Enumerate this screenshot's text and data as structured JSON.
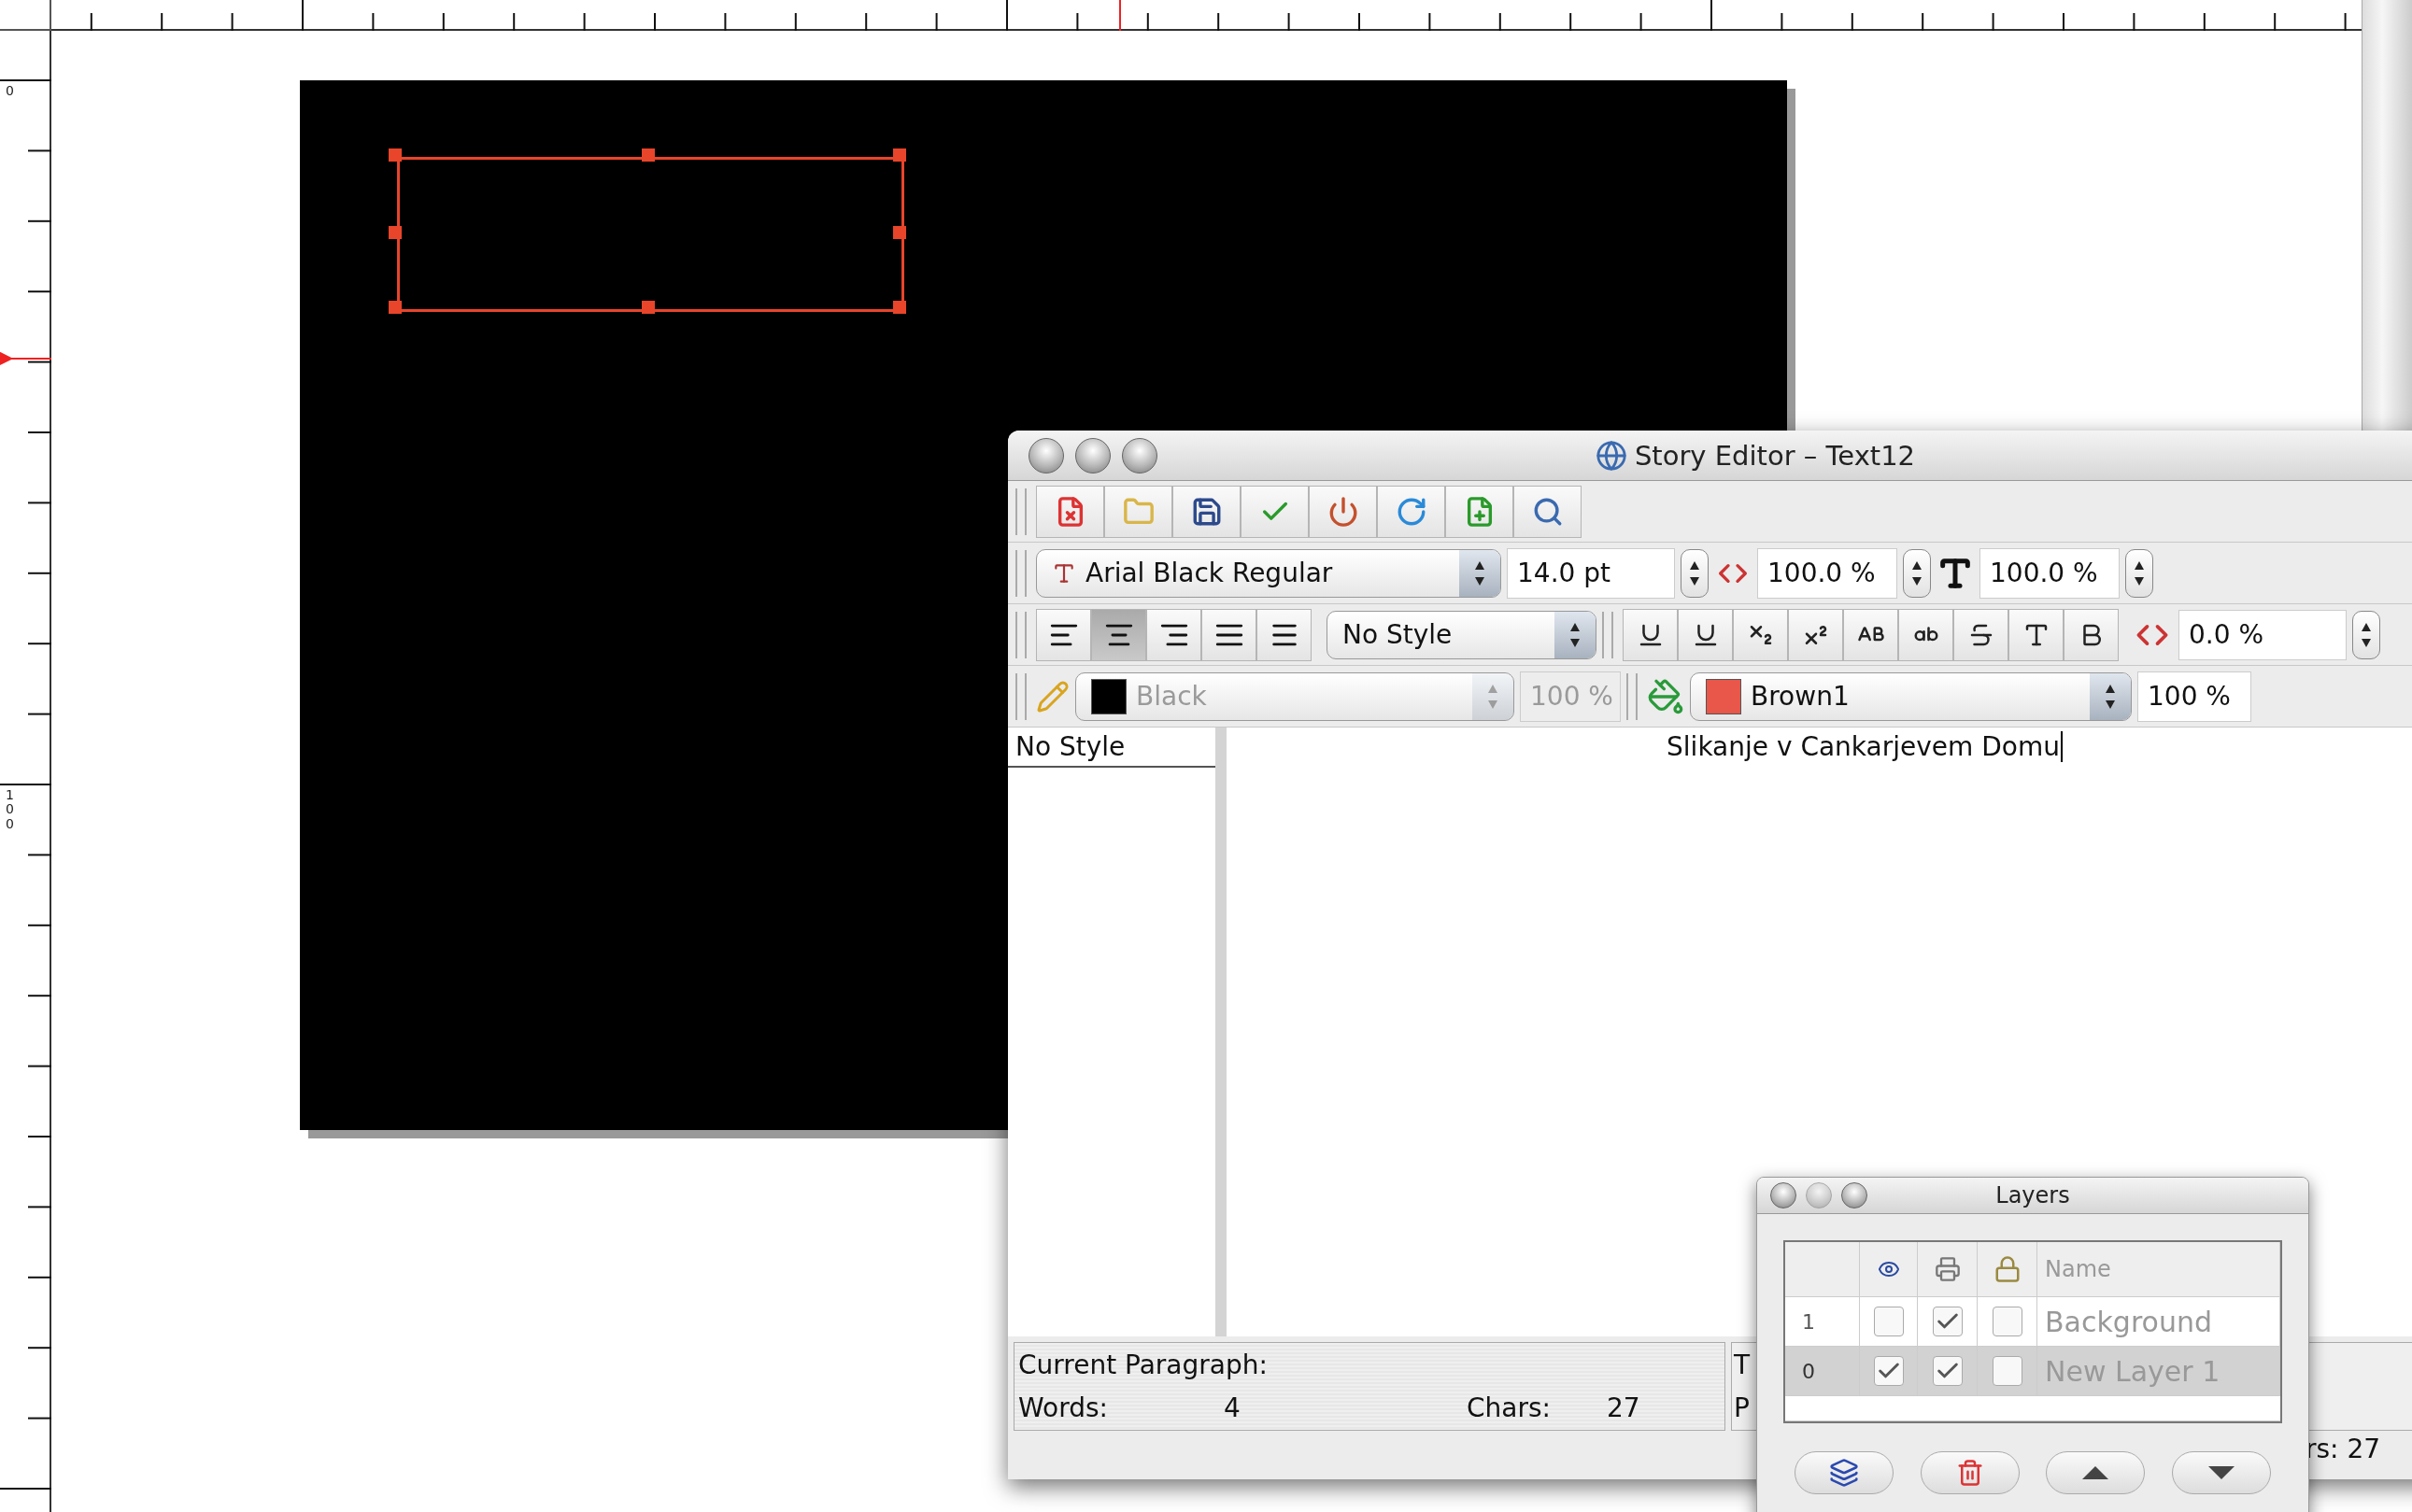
{
  "rulers": {
    "left_labels": [
      "0",
      "100"
    ]
  },
  "story_editor": {
    "title": "Story Editor – Text12",
    "font": "Arial Black Regular",
    "size": "14.0 pt",
    "width_scale": "100.0 %",
    "height_scale": "100.0 %",
    "alignment": [
      {
        "kind": "left",
        "selected": false
      },
      {
        "kind": "center",
        "selected": true
      },
      {
        "kind": "right",
        "selected": false
      },
      {
        "kind": "justify",
        "selected": false
      },
      {
        "kind": "force",
        "selected": false
      }
    ],
    "paragraph_style": "No Style",
    "tracking": "0.0 %",
    "line_color": {
      "name": "Black",
      "color": "#000000",
      "shade": "100 %",
      "disabled": true
    },
    "fill_color": {
      "name": "Brown1",
      "color": "#e8574a",
      "shade": "100 %",
      "disabled": false
    },
    "style_column": "No Style",
    "text": "Slikanje v Cankarjevem Domu",
    "status": {
      "heading": "Current Paragraph:",
      "words_label": "Words:",
      "words": "4",
      "chars_label": "Chars:",
      "chars": "27",
      "next_line_1": "T",
      "next_line_2": "P",
      "next_chars": "rs: 27"
    }
  },
  "layers_panel": {
    "title": "Layers",
    "name_column": "Name",
    "rows": [
      {
        "number": "1",
        "visible": false,
        "printable": true,
        "locked": false,
        "name": "Background",
        "selected": false
      },
      {
        "number": "0",
        "visible": true,
        "printable": true,
        "locked": false,
        "name": "New Layer 1",
        "selected": true
      }
    ]
  }
}
